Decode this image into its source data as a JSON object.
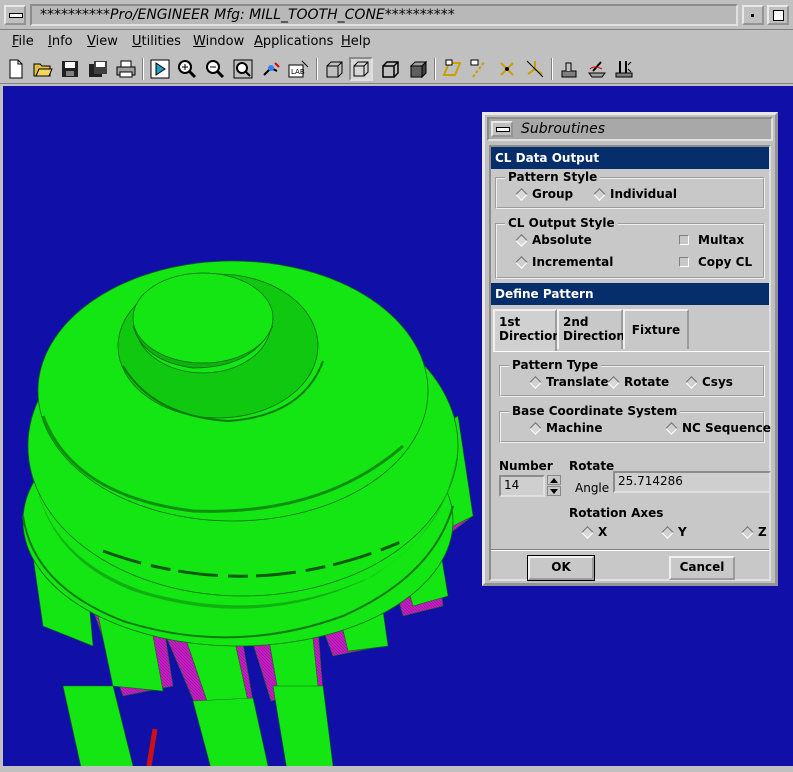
{
  "window": {
    "title": "**********Pro/ENGINEER Mfg: MILL_TOOTH_CONE**********"
  },
  "menubar": {
    "items": [
      "File",
      "Info",
      "View",
      "Utilities",
      "Window",
      "Applications",
      "Help"
    ]
  },
  "toolbar": {
    "icons": [
      "new-icon",
      "open-icon",
      "save-icon",
      "save-copy-icon",
      "print-icon",
      "view-play-icon",
      "zoom-in-icon",
      "zoom-out-icon",
      "refit-icon",
      "orient-icon",
      "named-view-icon",
      "wireframe-icon",
      "hidden-line-icon",
      "no-hidden-icon",
      "shaded-icon",
      "datum-plane-icon",
      "datum-axis-icon",
      "datum-point-icon",
      "csys-icon",
      "mfg-display-icon",
      "tool-path-icon",
      "mfg-params-icon"
    ]
  },
  "dialog": {
    "title": "Subroutines",
    "cl_output_header": "CL Data Output",
    "pattern_style": {
      "label": "Pattern Style",
      "options": [
        "Group",
        "Individual"
      ]
    },
    "cl_output_style": {
      "label": "CL Output Style",
      "radio_options": [
        "Absolute",
        "Incremental"
      ],
      "checkbox_options": [
        "Multax",
        "Copy CL"
      ]
    },
    "define_pattern_header": "Define Pattern",
    "tabs": [
      {
        "line1": "1st",
        "line2": "Direction"
      },
      {
        "line1": "2nd",
        "line2": "Direction"
      },
      {
        "line1": "Fixture",
        "line2": ""
      }
    ],
    "pattern_type": {
      "label": "Pattern Type",
      "options": [
        "Translate",
        "Rotate",
        "Csys"
      ]
    },
    "base_csys": {
      "label": "Base Coordinate System",
      "options": [
        "Machine",
        "NC Sequence"
      ]
    },
    "number_label": "Number",
    "number_value": "14",
    "rotate_label": "Rotate",
    "angle_label": "Angle",
    "angle_value": "25.714286",
    "rotation_axes": {
      "label": "Rotation Axes",
      "options": [
        "X",
        "Y",
        "Z"
      ]
    },
    "ok_label": "OK",
    "cancel_label": "Cancel"
  },
  "colors": {
    "viewport_bg": "#1010a8",
    "gear_green": "#14e614",
    "gear_magenta": "#c81ec8",
    "dialog_header": "#062e6a"
  }
}
